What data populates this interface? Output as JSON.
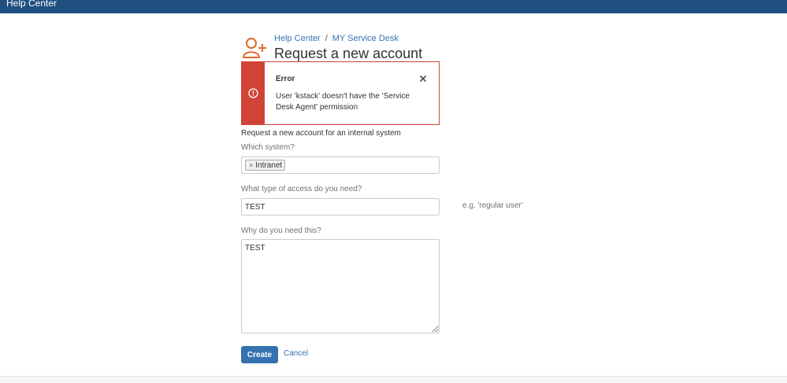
{
  "header": {
    "title": "Help Center"
  },
  "breadcrumb": {
    "home": "Help Center",
    "separator": "/",
    "desk": "MY Service Desk"
  },
  "page": {
    "title": "Request a new account"
  },
  "error": {
    "title": "Error",
    "message": "User 'kstack' doesn't have the 'Service Desk Agent' permission"
  },
  "form": {
    "description": "Request a new account for an internal system",
    "system": {
      "label": "Which system?",
      "selected": [
        "Intranet"
      ],
      "remove_glyph": "×"
    },
    "access": {
      "label": "What type of access do you need?",
      "value": "TEST",
      "hint": "e.g. 'regular user'"
    },
    "reason": {
      "label": "Why do you need this?",
      "value": "TEST"
    },
    "create_label": "Create",
    "cancel_label": "Cancel"
  },
  "colors": {
    "header_bg": "#205081",
    "accent": "#3572b0",
    "error": "#d04437",
    "icon": "#e06a2b"
  },
  "icons": {
    "portal": "add-user-icon",
    "error": "exclamation-circle-icon",
    "close": "close-icon"
  }
}
